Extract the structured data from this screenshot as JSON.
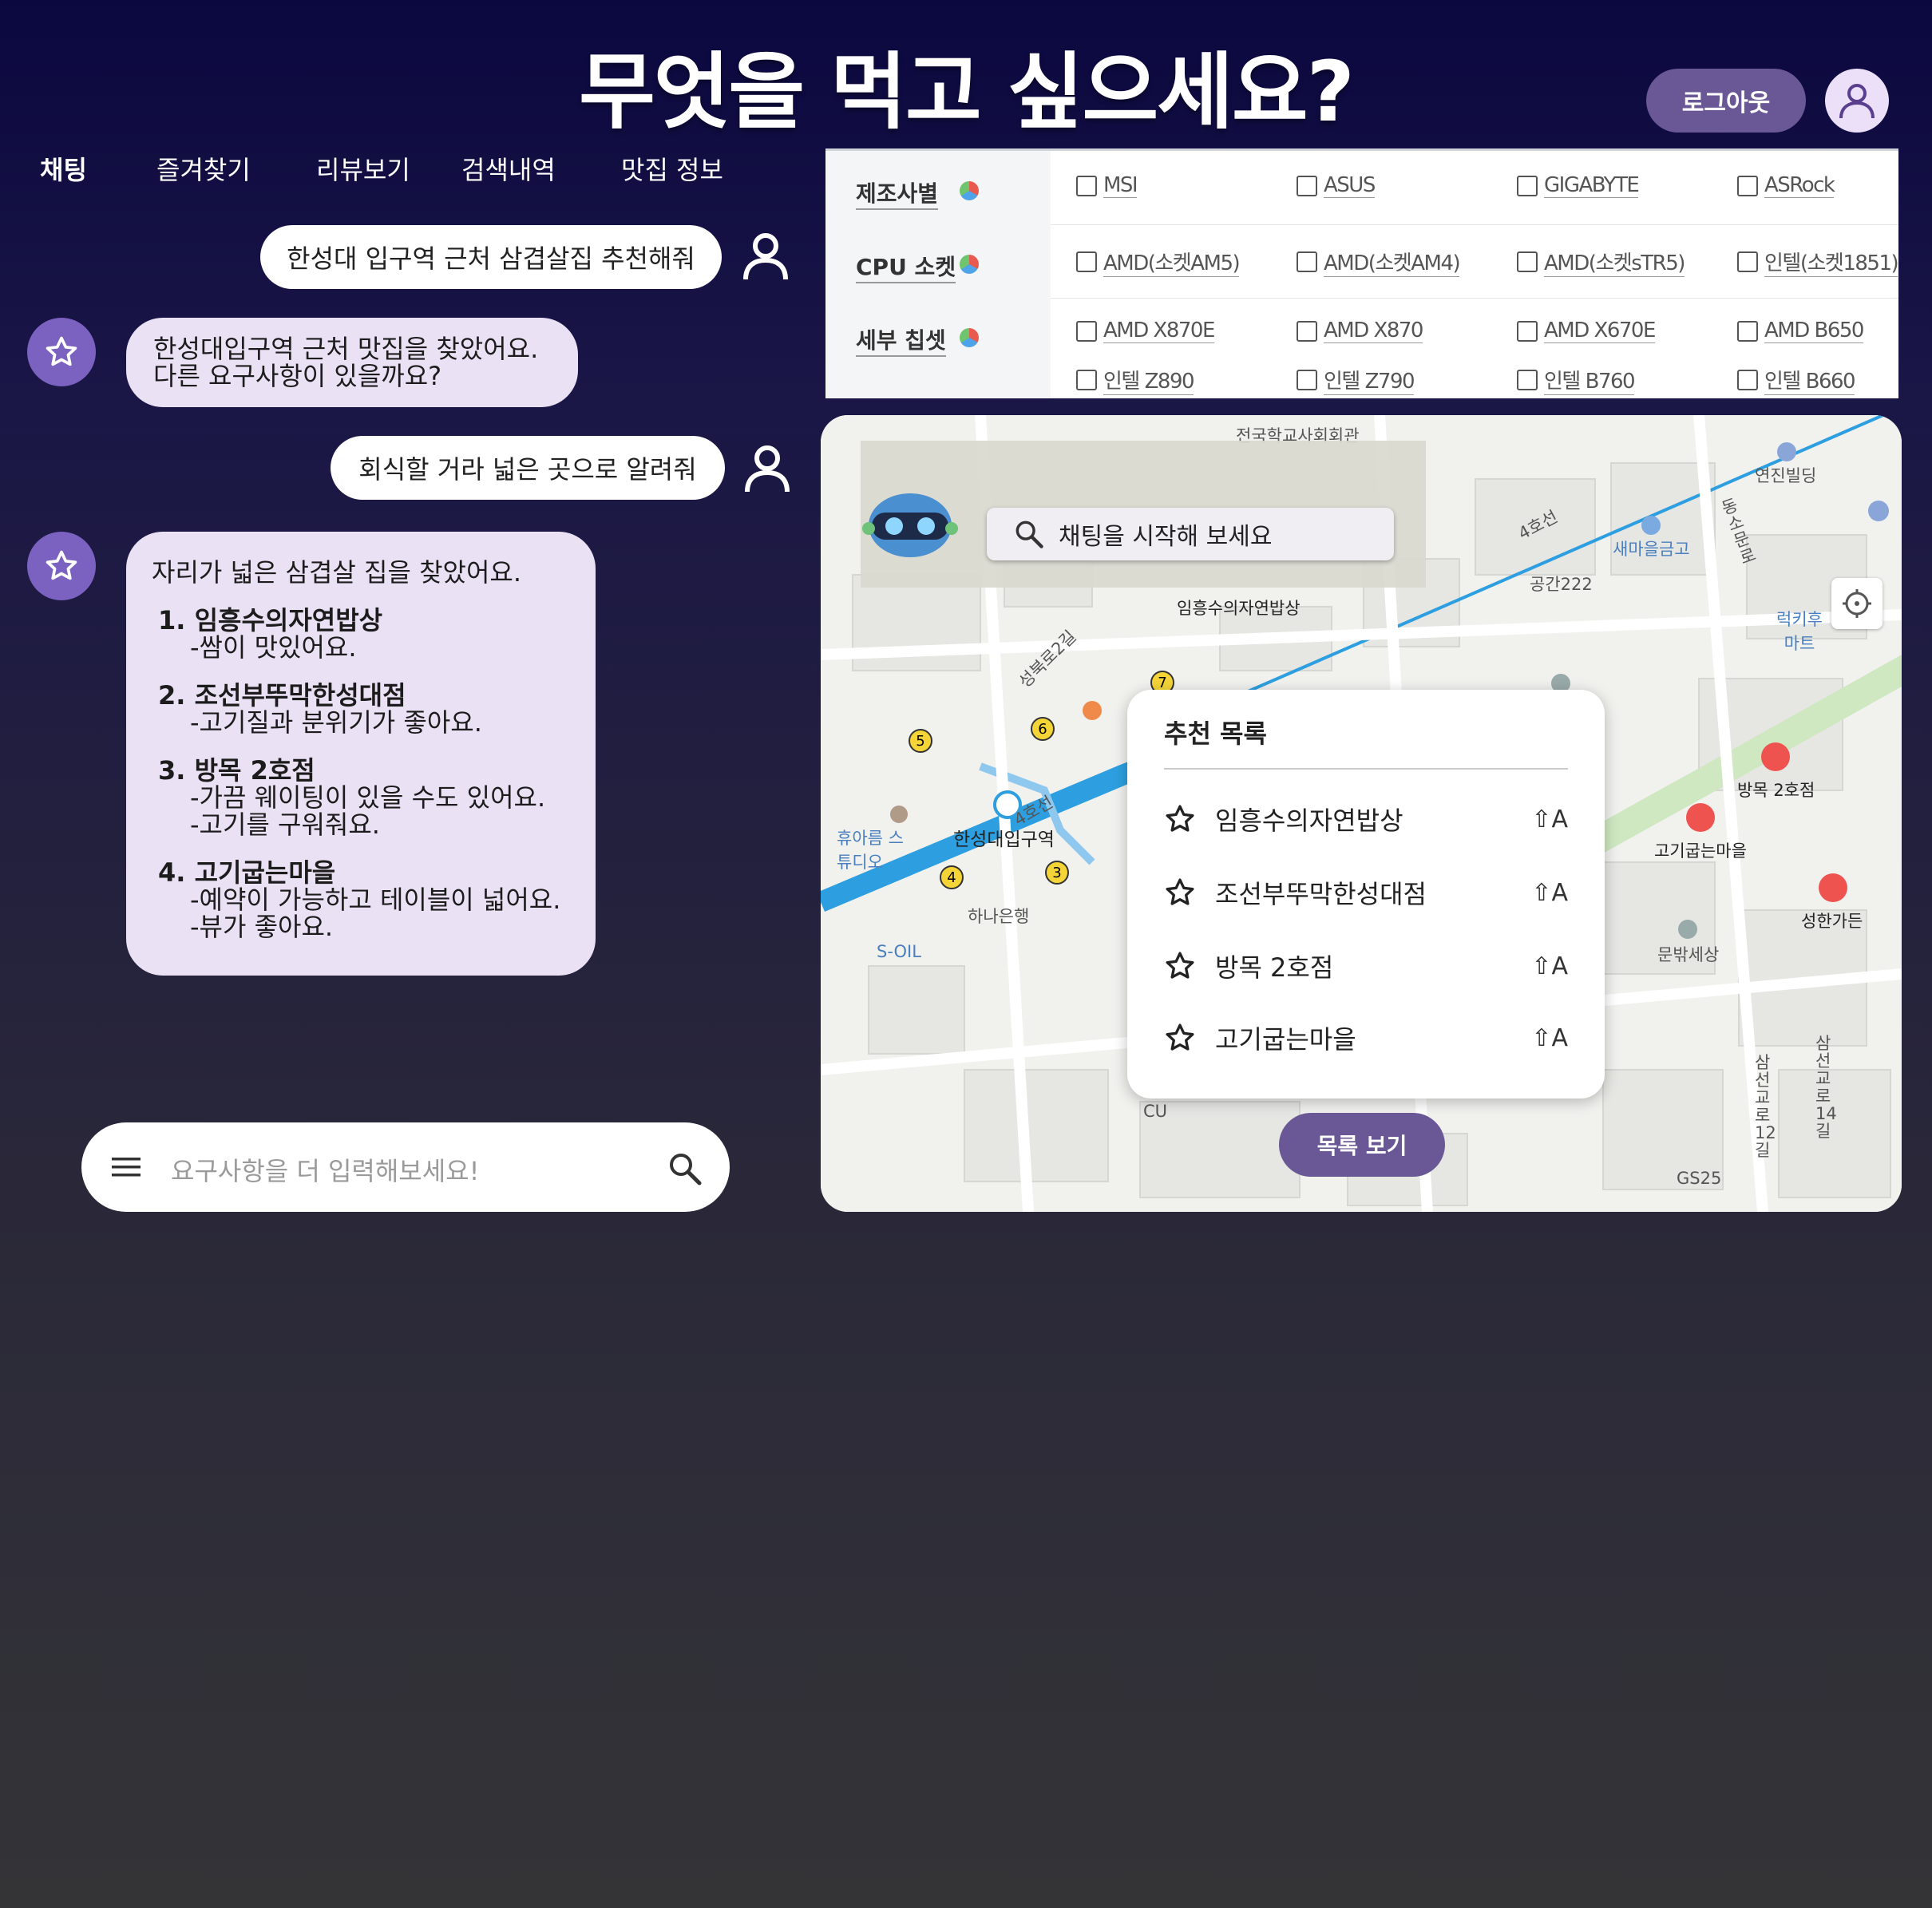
{
  "header": {
    "title": "무엇을 먹고 싶으세요?",
    "logout_label": "로그아웃"
  },
  "nav": {
    "items": [
      {
        "label": "채팅",
        "active": true
      },
      {
        "label": "즐겨찾기"
      },
      {
        "label": "리뷰보기"
      },
      {
        "label": "검색내역"
      },
      {
        "label": "맛집 정보"
      }
    ]
  },
  "chat": {
    "messages": [
      {
        "role": "user",
        "text": "한성대 입구역 근처 삼겹살집 추천해줘"
      },
      {
        "role": "bot",
        "lines": [
          "한성대입구역 근처 맛집을 찾았어요.",
          "다른 요구사항이 있을까요?"
        ]
      },
      {
        "role": "user",
        "text": "회식할 거라 넓은 곳으로 알려줘"
      },
      {
        "role": "bot",
        "intro": "자리가 넓은 삼겹살 집을 찾았어요.",
        "items": [
          {
            "title": "1. 임흥수의자연밥상",
            "details": [
              "-쌈이 맛있어요."
            ]
          },
          {
            "title": "2. 조선부뚜막한성대점",
            "details": [
              "-고기질과 분위기가 좋아요."
            ]
          },
          {
            "title": "3. 방목 2호점",
            "details": [
              "-가끔 웨이팅이 있을 수도 있어요.",
              "-고기를 구워줘요."
            ]
          },
          {
            "title": "4. 고기굽는마을",
            "details": [
              "-예약이 가능하고 테이블이 넓어요.",
              "-뷰가 좋아요."
            ]
          }
        ]
      }
    ],
    "input_placeholder": "요구사항을 더 입력해보세요!"
  },
  "filter": {
    "rows": [
      {
        "label": "제조사별",
        "options": [
          [
            "MSI",
            "ASUS",
            "GIGABYTE",
            "ASRock"
          ]
        ]
      },
      {
        "label": "CPU 소켓",
        "options": [
          [
            "AMD(소켓AM5)",
            "AMD(소켓AM4)",
            "AMD(소켓sTR5)",
            "인텔(소켓1851)"
          ]
        ]
      },
      {
        "label": "세부 칩셋",
        "options": [
          [
            "AMD X870E",
            "AMD X870",
            "AMD X670E",
            "AMD B650"
          ],
          [
            "인텔 Z890",
            "인텔 Z790",
            "인텔 B760",
            "인텔 B660"
          ]
        ]
      }
    ]
  },
  "map": {
    "chat_search_label": "채팅을 시작해 보세요",
    "labels": {
      "school": "전국학교사회회관",
      "imheung": "임흥수의자연밥상",
      "space222": "공간222",
      "saemaeul": "새마을금고",
      "yeonjin": "연진빌딩",
      "lucky": "럭키후 마트",
      "station": "한성대입구역",
      "hana": "하나은행",
      "soil": "S-OIL",
      "huareum": "휴아름 스튜디오",
      "bangmok": "방목 2호점",
      "gogi": "고기굽는마을",
      "sunghan": "성한가든",
      "munbak": "문밖세상",
      "cu": "CU",
      "gs25": "GS25",
      "line4": "4호선",
      "seongbukro": "성북로2길",
      "samseon": "삼선교로14길",
      "samseon2": "삼선교로12길",
      "dongsomun": "동소문로"
    },
    "exit_numbers": [
      "3",
      "4",
      "5",
      "6",
      "7"
    ],
    "recommend": {
      "title": "추천 목록",
      "shortcut": "⇧A",
      "items": [
        "임흥수의자연밥상",
        "조선부뚜막한성대점",
        "방목 2호점",
        "고기굽는마을"
      ]
    },
    "list_button": "목록 보기"
  },
  "colors": {
    "accent": "#6a5796",
    "bot_bubble": "#ebe1f5",
    "bot_avatar": "#7b62c0",
    "line4": "#2d9fe0"
  }
}
